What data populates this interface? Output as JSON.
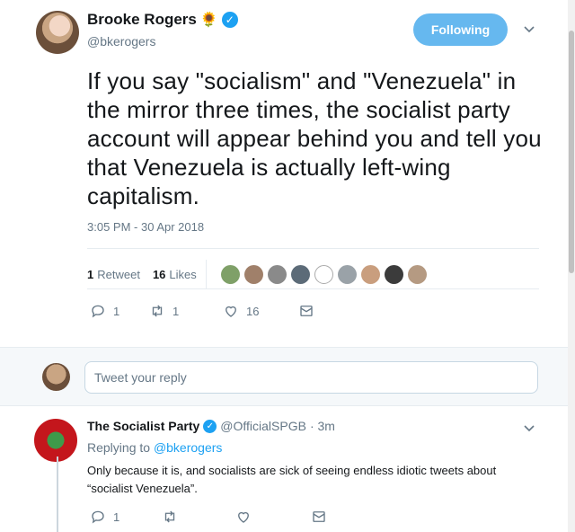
{
  "tweet": {
    "author_name": "Brooke Rogers",
    "author_emoji": "🌻",
    "author_handle": "@bkerogers",
    "follow_label": "Following",
    "text": "If you say \"socialism\" and \"Venezuela\" in the mirror three times, the socialist party account will appear behind you and tell you that Venezuela is actually left-wing capitalism.",
    "timestamp": "3:05 PM - 30 Apr 2018",
    "retweet_count": "1",
    "retweet_label": "Retweet",
    "like_count": "16",
    "like_label": "Likes",
    "actions": {
      "reply_count": "1",
      "retweet_count": "1",
      "like_count": "16"
    }
  },
  "reply_box": {
    "placeholder": "Tweet your reply"
  },
  "reply": {
    "author_name": "The Socialist Party",
    "author_handle": "@OfficialSPGB",
    "time": "· 3m",
    "replying_prefix": "Replying to",
    "replying_to": "@bkerogers",
    "text": "Only because it is, and socialists are sick of seeing endless idiotic tweets about “socialist Venezuela”.",
    "actions": {
      "reply_count": "1"
    }
  },
  "colors": {
    "accent": "#1da1f2",
    "follow_button": "#66b8ef",
    "muted": "#657786",
    "text": "#14171a"
  },
  "icons": [
    "chevron-down-icon",
    "verified-icon",
    "reply-icon",
    "retweet-icon",
    "like-icon",
    "message-icon"
  ]
}
